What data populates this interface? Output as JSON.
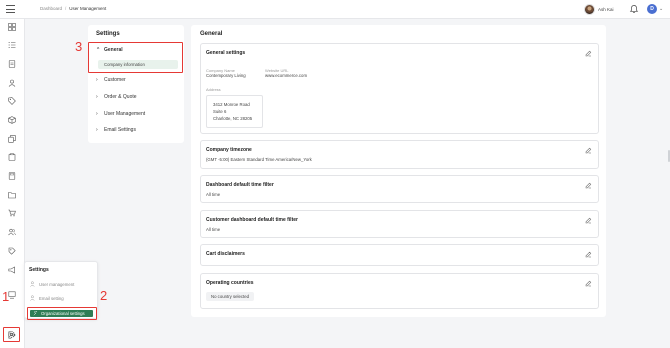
{
  "topbar": {
    "breadcrumb": [
      "Dashboard",
      "User Management"
    ],
    "separator": "/",
    "user_name": "Ash Kai",
    "account_initial": "D"
  },
  "rail": {
    "icons": [
      "grid-icon",
      "list-check-icon",
      "document-icon",
      "users-icon",
      "tag-icon",
      "box-icon",
      "copy-icon",
      "clipboard-icon",
      "calculator-icon",
      "folder-icon",
      "cart-icon",
      "user-group-icon",
      "price-tag-icon",
      "megaphone-icon",
      "integration-icon",
      "settings-gear-icon",
      "logout-icon"
    ]
  },
  "flyout": {
    "title": "Settings",
    "items": [
      "User management",
      "Email setting",
      "Organizational settings"
    ],
    "active_index": 2
  },
  "annotations": [
    "1",
    "2",
    "3"
  ],
  "settings_nav": {
    "title": "Settings",
    "items": [
      {
        "label": "General",
        "expanded": true
      },
      {
        "label": "Customer"
      },
      {
        "label": "Order & Quote"
      },
      {
        "label": "User Management"
      },
      {
        "label": "Email Settings"
      }
    ],
    "sub_item": "Company information"
  },
  "main": {
    "title": "General",
    "general_settings": {
      "title": "General settings",
      "company_name_label": "Company Name",
      "company_name": "Contemporary Living",
      "website_label": "Website URL",
      "website": "www.ecommerce.com",
      "address_label": "Address",
      "address_lines": [
        "3412 Monroe Road",
        "Suite 6",
        "Charlotte, NC 28205"
      ]
    },
    "timezone": {
      "title": "Company timezone",
      "value": "(GMT -5:00) Eastern Standard Time America/New_York"
    },
    "dashboard_filter": {
      "title": "Dashboard default time filter",
      "value": "All time"
    },
    "customer_filter": {
      "title": "Customer dashboard default time filter",
      "value": "All time"
    },
    "cart_disclaimers": {
      "title": "Cart disclaimers"
    },
    "operating_countries": {
      "title": "Operating countries",
      "value": "No country selected"
    }
  },
  "colors": {
    "accent_green": "#2e7d55",
    "annotation_red": "#e53935",
    "avatar_blue": "#4a6fd1"
  }
}
